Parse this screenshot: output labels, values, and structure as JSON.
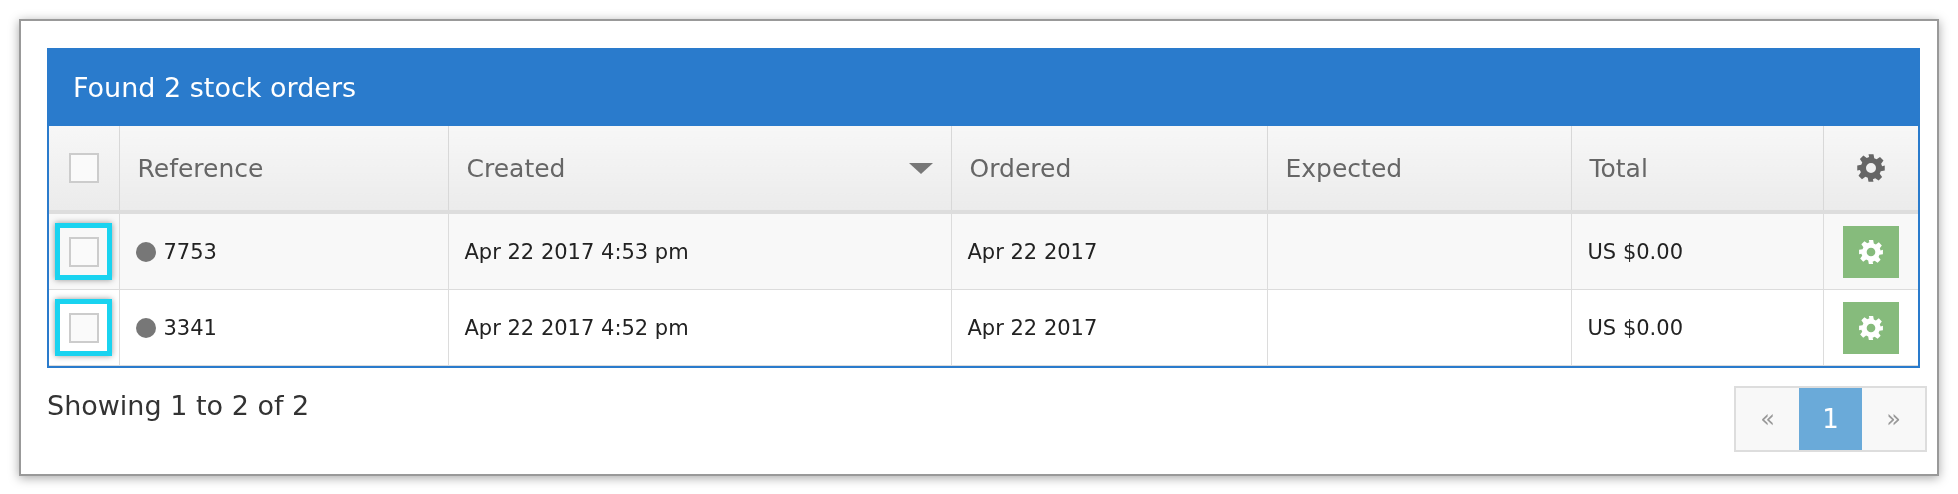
{
  "panel": {
    "title": "Found 2 stock orders"
  },
  "table": {
    "select_all": {
      "checked": false
    },
    "columns": [
      {
        "label": "Reference",
        "sorted": false
      },
      {
        "label": "Created",
        "sorted": true
      },
      {
        "label": "Ordered",
        "sorted": false
      },
      {
        "label": "Expected",
        "sorted": false
      },
      {
        "label": "Total",
        "sorted": false
      }
    ],
    "rows": [
      {
        "checked": false,
        "highlighted": true,
        "color": "#777777",
        "reference": "7753",
        "created": "Apr 22 2017 4:53 pm",
        "ordered": "Apr 22 2017",
        "total": "US $0.00"
      },
      {
        "checked": false,
        "highlighted": true,
        "color": "#777777",
        "reference": "3341",
        "created": "Apr 22 2017 4:52 pm",
        "ordered": "Apr 22 2017",
        "total": "US $0.00"
      }
    ]
  },
  "footer": {
    "summary": "Showing 1 to 2 of 2",
    "pagination": [
      {
        "kind": "prev",
        "label": "«",
        "selected": false
      },
      {
        "kind": "page",
        "label": "1",
        "selected": true
      },
      {
        "kind": "next",
        "label": "»",
        "selected": false
      }
    ]
  }
}
